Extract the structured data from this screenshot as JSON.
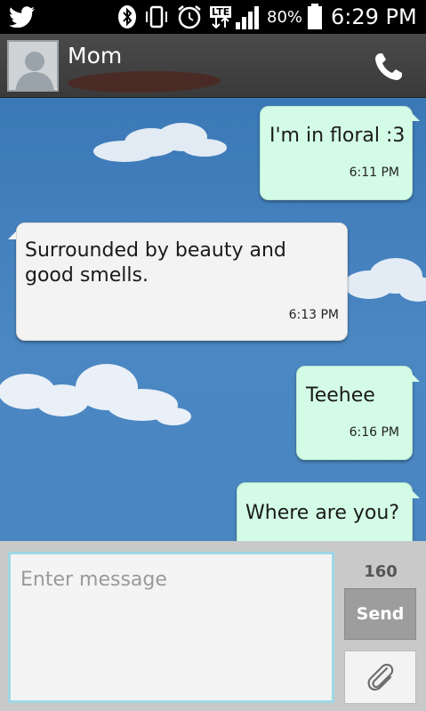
{
  "status_bar": {
    "icons": [
      "twitter-icon",
      "bluetooth-icon",
      "vibrate-icon",
      "alarm-icon",
      "lte-icon",
      "signal-icon",
      "battery-icon"
    ],
    "network_label": "LTE",
    "battery_percent": "80%",
    "time": "6:29 PM"
  },
  "header": {
    "contact_name": "Mom",
    "call_icon": "phone-icon"
  },
  "messages": [
    {
      "direction": "sent",
      "text": "I'm in floral :3",
      "time": "6:11 PM"
    },
    {
      "direction": "received",
      "text": "Surrounded by beauty and good smells.",
      "time": "6:13 PM"
    },
    {
      "direction": "sent",
      "text": "Teehee",
      "time": "6:16 PM"
    },
    {
      "direction": "sent",
      "text": "Where are you?",
      "time": ""
    }
  ],
  "composer": {
    "placeholder": "Enter message",
    "char_count": "160",
    "send_label": "Send",
    "attach_icon": "paperclip-icon"
  },
  "colors": {
    "sent_bubble": "#d3fbe6",
    "received_bubble": "#f3f3f3",
    "background_sky": "#4a86c1",
    "input_border": "#9fd7e6"
  }
}
